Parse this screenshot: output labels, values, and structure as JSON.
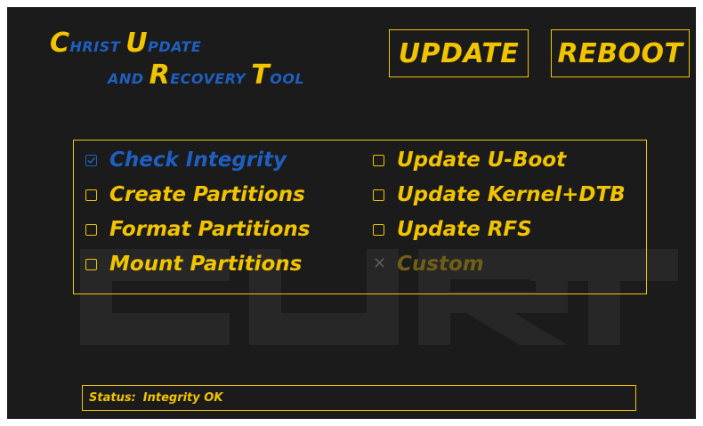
{
  "app": {
    "title_line1": {
      "big1": "C",
      "small1": "hrist",
      "big2": "U",
      "small2": "pdate"
    },
    "title_line2": {
      "small1": "and",
      "big1": "R",
      "small2": "ecovery",
      "big2": "T",
      "small3": "ool"
    },
    "watermark": "CURT"
  },
  "actions": {
    "update_label": "UPDATE",
    "reboot_label": "REBOOT"
  },
  "options": [
    {
      "label": "Check Integrity",
      "state": "checked"
    },
    {
      "label": "Create Partitions",
      "state": "unchecked"
    },
    {
      "label": "Format Partitions",
      "state": "unchecked"
    },
    {
      "label": "Mount Partitions",
      "state": "unchecked"
    },
    {
      "label": "Update U-Boot",
      "state": "unchecked"
    },
    {
      "label": "Update Kernel+DTB",
      "state": "unchecked"
    },
    {
      "label": "Update RFS",
      "state": "unchecked"
    },
    {
      "label": "Custom",
      "state": "disabled"
    }
  ],
  "status": {
    "label": "Status:",
    "value": "Integrity OK"
  },
  "colors": {
    "background": "#1b1b1b",
    "accent_yellow": "#f2c400",
    "accent_blue": "#1f5fc0",
    "disabled_yellow": "#6f5f16",
    "watermark": "#2a2a2a"
  },
  "icons": {
    "checked": "checkbox-checked-icon",
    "unchecked": "checkbox-empty-icon",
    "disabled": "cross-icon"
  }
}
